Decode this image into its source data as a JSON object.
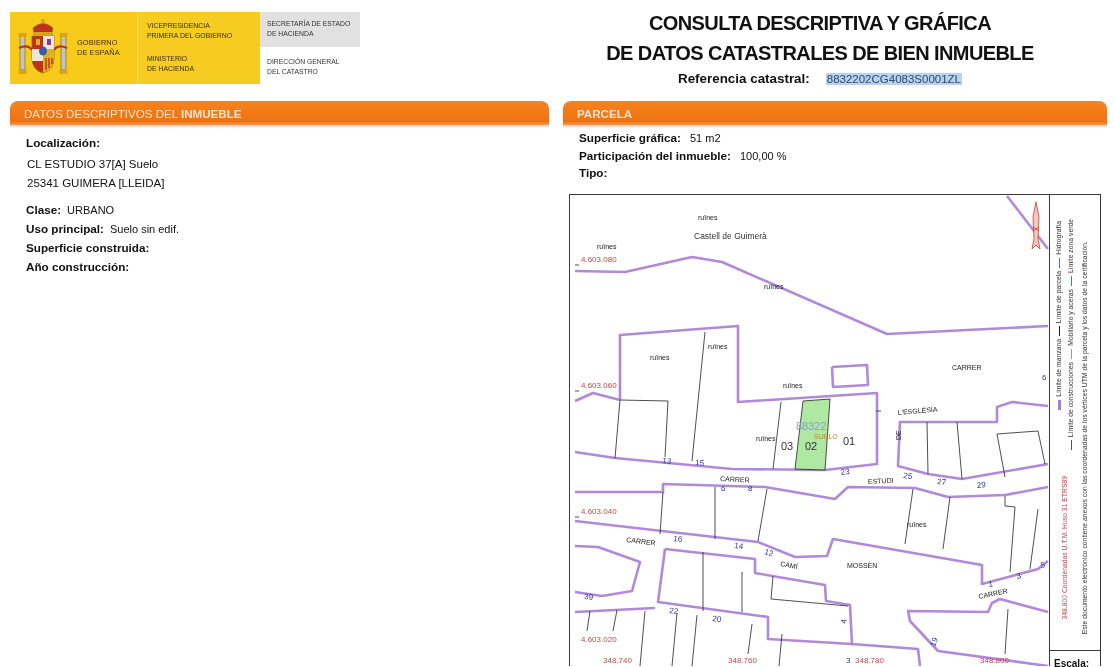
{
  "header": {
    "logo": {
      "government": [
        "GOBIERNO",
        "DE ESPAÑA"
      ],
      "vicepresidency": [
        "VICEPRESIDENCIA",
        "PRIMERA DEL GOBIERNO"
      ],
      "ministry": [
        "MINISTERIO",
        "DE HACIENDA"
      ],
      "secretariat": [
        "SECRETARÍA DE ESTADO",
        "DE HACIENDA"
      ],
      "directorate": [
        "DIRECCIÓN GENERAL",
        "DEL CATASTRO"
      ]
    },
    "title": [
      "CONSULTA DESCRIPTIVA Y GRÁFICA",
      "DE DATOS CATASTRALES DE BIEN INMUEBLE"
    ],
    "reference": {
      "label": "Referencia catastral:",
      "value": "8832202CG4083S0001ZL",
      "highlighted": true
    }
  },
  "descriptive": {
    "title": "DATOS DESCRIPTIVOS DEL **INMUEBLE**",
    "location": {
      "label": "Localización:",
      "lines": [
        "CL ESTUDIO 37[A] Suelo",
        "25341 GUIMERA [LLEIDA]"
      ]
    },
    "fields": [
      {
        "label": "Clase:",
        "value": "URBANO"
      },
      {
        "label": "Uso principal:",
        "value": "Suelo sin edif."
      },
      {
        "label": "Superficie construida:"
      },
      {
        "label": "Año construcción:"
      }
    ]
  },
  "parcel": {
    "title": "PARCELA",
    "fields": [
      {
        "label": "Superficie gráfica:",
        "value": "51 m2"
      },
      {
        "label": "Participación del inmueble:",
        "value": "100,00 %"
      },
      {
        "label": "Tipo:"
      }
    ],
    "map": {
      "labels": [
        {
          "kind": "ruins",
          "text": "ruïnes"
        },
        {
          "kind": "place",
          "text": "Castell de Guimerà"
        },
        {
          "kind": "ruins",
          "text": "ruïnes"
        },
        {
          "kind": "coord",
          "text": "4.603.080"
        },
        {
          "kind": "ruins",
          "text": "ruïnes"
        },
        {
          "kind": "ruins",
          "text": "ruïnes"
        },
        {
          "kind": "ruins",
          "text": "ruïnes"
        },
        {
          "kind": "coord",
          "text": "4.603.060"
        },
        {
          "kind": "ruins",
          "text": "ruïnes"
        },
        {
          "kind": "street",
          "text": "CARRER"
        },
        {
          "kind": "street",
          "text": "L'ESGLÉSIA"
        },
        {
          "kind": "street",
          "text": "DE"
        },
        {
          "kind": "parcel",
          "text": "88322"
        },
        {
          "kind": "ruins",
          "text": "ruïnes"
        },
        {
          "kind": "use",
          "text": "SUELO"
        },
        {
          "kind": "subparcel",
          "text": "03"
        },
        {
          "kind": "subparcel",
          "text": "02"
        },
        {
          "kind": "subparcel",
          "text": "01"
        },
        {
          "kind": "number",
          "text": "13"
        },
        {
          "kind": "number",
          "text": "15"
        },
        {
          "kind": "number",
          "text": "23"
        },
        {
          "kind": "number",
          "text": "25"
        },
        {
          "kind": "number",
          "text": "27"
        },
        {
          "kind": "number",
          "text": "29"
        },
        {
          "kind": "street",
          "text": "CARRER"
        },
        {
          "kind": "number",
          "text": "6"
        },
        {
          "kind": "number",
          "text": "8"
        },
        {
          "kind": "street",
          "text": "ESTUDI"
        },
        {
          "kind": "coord",
          "text": "4.603.040"
        },
        {
          "kind": "ruins",
          "text": "ruïnes"
        },
        {
          "kind": "street",
          "text": "CARRER"
        },
        {
          "kind": "number",
          "text": "16"
        },
        {
          "kind": "number",
          "text": "14"
        },
        {
          "kind": "number",
          "text": "12"
        },
        {
          "kind": "street",
          "text": "CAMÍ"
        },
        {
          "kind": "street",
          "text": "MOSSÈN"
        },
        {
          "kind": "number",
          "text": "1"
        },
        {
          "kind": "number",
          "text": "3"
        },
        {
          "kind": "number",
          "text": "5"
        },
        {
          "kind": "street",
          "text": "CARRER"
        },
        {
          "kind": "number",
          "text": "39"
        },
        {
          "kind": "number",
          "text": "22"
        },
        {
          "kind": "number",
          "text": "20"
        },
        {
          "kind": "number",
          "text": "4"
        },
        {
          "kind": "number",
          "text": "19"
        },
        {
          "kind": "coord",
          "text": "4.603.020"
        },
        {
          "kind": "coord",
          "text": "348.740"
        },
        {
          "kind": "coord",
          "text": "348.760"
        },
        {
          "kind": "number",
          "text": "3"
        },
        {
          "kind": "coord",
          "text": "348.780"
        },
        {
          "kind": "coord",
          "text": "348.800"
        },
        {
          "kind": "number",
          "text": "6"
        }
      ],
      "legend": [
        {
          "kind": "block",
          "text": "Límite de manzana"
        },
        {
          "kind": "parcel",
          "text": "Límite de parcela"
        },
        {
          "kind": "water",
          "text": "Hidrografía"
        },
        {
          "kind": "building",
          "text": "Límite de construcciones"
        },
        {
          "kind": "furniture",
          "text": "Mobiliario y aceras"
        },
        {
          "kind": "green",
          "text": "Límite zona verde"
        }
      ],
      "coordinates_note": "348.800 Coordenadas U.T.M. Huso 31 ETRS89",
      "document_note": "Este documento electrónico contiene anexos con las coordenadas de los vértices UTM de la parcela y los datos de la certificación.",
      "scale_label": "Escala:"
    }
  }
}
